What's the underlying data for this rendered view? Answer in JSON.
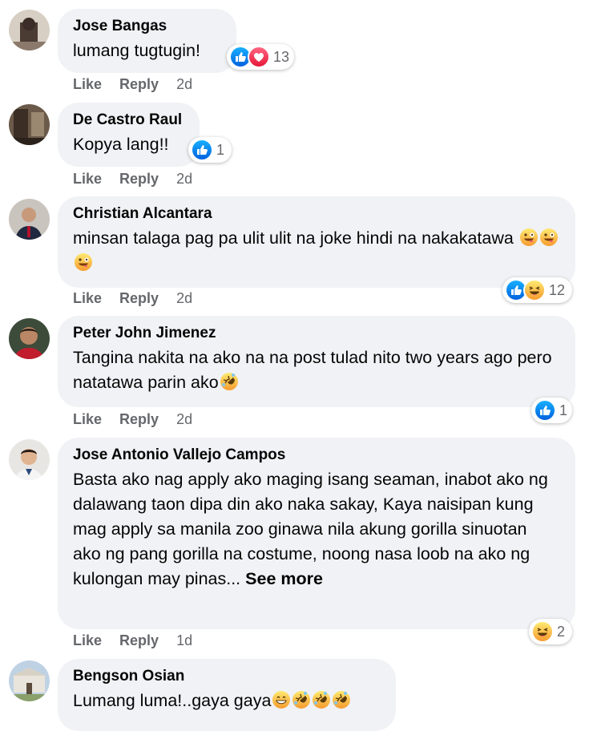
{
  "comments": [
    {
      "author": "Jose Bangas",
      "text": "lumang tugtugin!",
      "actions": {
        "like": "Like",
        "reply": "Reply",
        "time": "2d"
      },
      "reactions": {
        "icons": [
          "like-icon",
          "love-icon"
        ],
        "count": "13"
      }
    },
    {
      "author": "De Castro Raul",
      "text": "Kopya lang!!",
      "actions": {
        "like": "Like",
        "reply": "Reply",
        "time": "2d"
      },
      "reactions": {
        "icons": [
          "like-icon"
        ],
        "count": "1"
      }
    },
    {
      "author": "Christian Alcantara",
      "text": "minsan talaga pag pa ulit ulit na joke hindi na nakakatawa",
      "emojis": [
        "zany-face-emoji",
        "zany-face-emoji",
        "zany-face-emoji"
      ],
      "actions": {
        "like": "Like",
        "reply": "Reply",
        "time": "2d"
      },
      "reactions": {
        "icons": [
          "like-icon",
          "haha-icon"
        ],
        "count": "12"
      }
    },
    {
      "author": "Peter John Jimenez",
      "text": "Tangina nakita na ako na na post tulad nito two years ago pero natatawa parin ako",
      "emojis": [
        "rofl-emoji"
      ],
      "actions": {
        "like": "Like",
        "reply": "Reply",
        "time": "2d"
      },
      "reactions": {
        "icons": [
          "like-icon"
        ],
        "count": "1"
      }
    },
    {
      "author": "Jose Antonio Vallejo Campos",
      "text": "Basta ako nag apply ako maging isang seaman, inabot ako ng dalawang taon dipa din ako naka sakay, Kaya naisipan kung mag apply sa manila zoo ginawa nila akung gorilla sinuotan ako ng pang gorilla na costume, noong nasa loob na ako ng kulongan may pinas...",
      "see_more": "See more",
      "actions": {
        "like": "Like",
        "reply": "Reply",
        "time": "1d"
      },
      "reactions": {
        "icons": [
          "haha-icon"
        ],
        "count": "2"
      }
    },
    {
      "author": "Bengson Osian",
      "text": "Lumang luma!..gaya gaya",
      "emojis": [
        "grinning-emoji",
        "rofl-emoji",
        "rofl-emoji",
        "rofl-emoji"
      ]
    }
  ],
  "colors": {
    "bubble": "#f0f2f5",
    "meta_text": "#65676b",
    "like_blue": "#1877f2",
    "love_red": "#f33e58",
    "haha_yellow": "#f7b125"
  }
}
